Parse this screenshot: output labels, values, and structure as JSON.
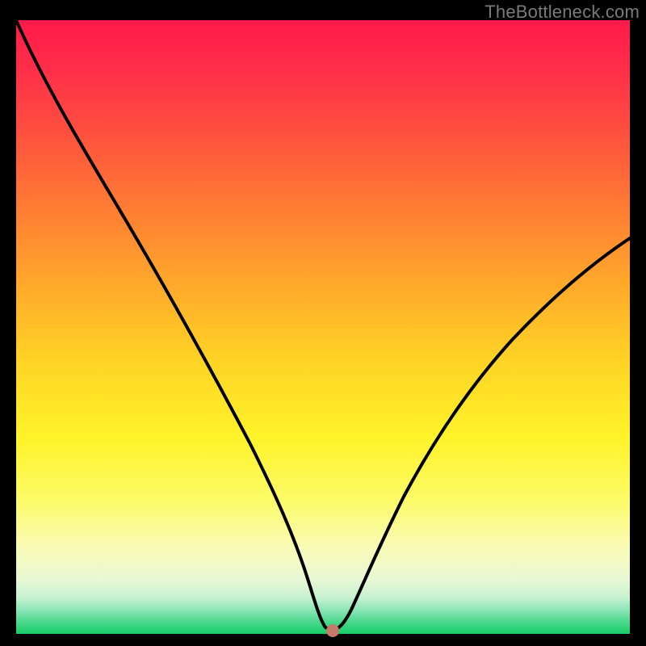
{
  "watermark": "TheBottleneck.com",
  "colors": {
    "gradient_top": "#ff1a4b",
    "gradient_mid": "#fff329",
    "gradient_bottom": "#16cd66",
    "curve": "#000000",
    "marker": "#c57a6a",
    "frame": "#000000"
  },
  "chart_data": {
    "type": "line",
    "title": "",
    "xlabel": "",
    "ylabel": "",
    "xlim": [
      0,
      100
    ],
    "ylim": [
      0,
      100
    ],
    "x": [
      0,
      4,
      8,
      12,
      16,
      20,
      24,
      28,
      32,
      36,
      40,
      44,
      47,
      49,
      50,
      51,
      52,
      54,
      58,
      62,
      66,
      70,
      74,
      78,
      82,
      86,
      90,
      94,
      98,
      100
    ],
    "values": [
      100,
      93,
      85.5,
      77.5,
      69,
      60.5,
      52,
      43.5,
      35,
      27,
      19,
      11,
      5,
      1.3,
      0.5,
      0.5,
      0.8,
      2.5,
      7,
      12.5,
      18,
      23.5,
      29,
      34,
      39,
      43.5,
      47.5,
      51,
      54,
      55.5
    ],
    "marker": {
      "x": 51,
      "y": 0.5
    },
    "description": "V-shaped bottleneck curve; minimum (optimal point) occurs near x≈51 where bottleneck ≈0. Left branch starts near 100% at x=0 and falls roughly linearly/convex to the minimum; right branch rises concave to about 55% at x=100."
  }
}
